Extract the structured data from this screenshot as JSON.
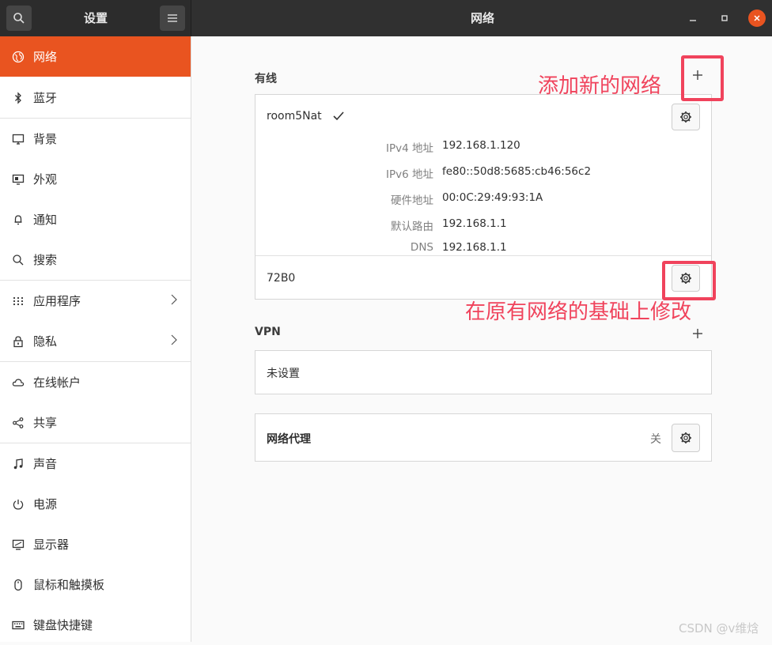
{
  "header": {
    "app_title": "设置",
    "page_title": "网络"
  },
  "sidebar": {
    "items": [
      {
        "label": "网络",
        "icon": "network-icon"
      },
      {
        "label": "蓝牙",
        "icon": "bluetooth-icon"
      },
      {
        "label": "背景",
        "icon": "background-icon"
      },
      {
        "label": "外观",
        "icon": "appearance-icon"
      },
      {
        "label": "通知",
        "icon": "bell-icon"
      },
      {
        "label": "搜索",
        "icon": "search-icon"
      },
      {
        "label": "应用程序",
        "icon": "apps-grid-icon"
      },
      {
        "label": "隐私",
        "icon": "lock-icon"
      },
      {
        "label": "在线帐户",
        "icon": "cloud-icon"
      },
      {
        "label": "共享",
        "icon": "share-icon"
      },
      {
        "label": "声音",
        "icon": "music-note-icon"
      },
      {
        "label": "电源",
        "icon": "power-icon"
      },
      {
        "label": "显示器",
        "icon": "display-icon"
      },
      {
        "label": "鼠标和触摸板",
        "icon": "mouse-icon"
      },
      {
        "label": "键盘快捷键",
        "icon": "keyboard-icon"
      }
    ],
    "selected": "网络"
  },
  "wired": {
    "section_title": "有线",
    "connections": [
      {
        "name": "room5Nat",
        "details": [
          {
            "label": "IPv4 地址",
            "value": "192.168.1.120"
          },
          {
            "label": "IPv6 地址",
            "value": "fe80::50d8:5685:cb46:56c2"
          },
          {
            "label": "硬件地址",
            "value": "00:0C:29:49:93:1A"
          },
          {
            "label": "默认路由",
            "value": "192.168.1.1"
          },
          {
            "label": "DNS",
            "value": "192.168.1.1"
          }
        ]
      },
      {
        "name": "72B0"
      }
    ]
  },
  "vpn": {
    "section_title": "VPN",
    "empty_text": "未设置"
  },
  "proxy": {
    "title": "网络代理",
    "status": "关"
  },
  "annotations": {
    "add_note": "添加新的网络",
    "edit_note": "在原有网络的基础上修改",
    "color": "#f0435c"
  },
  "watermark": "CSDN @v维焓",
  "colors": {
    "accent": "#e95420",
    "titlebar": "#303030"
  }
}
